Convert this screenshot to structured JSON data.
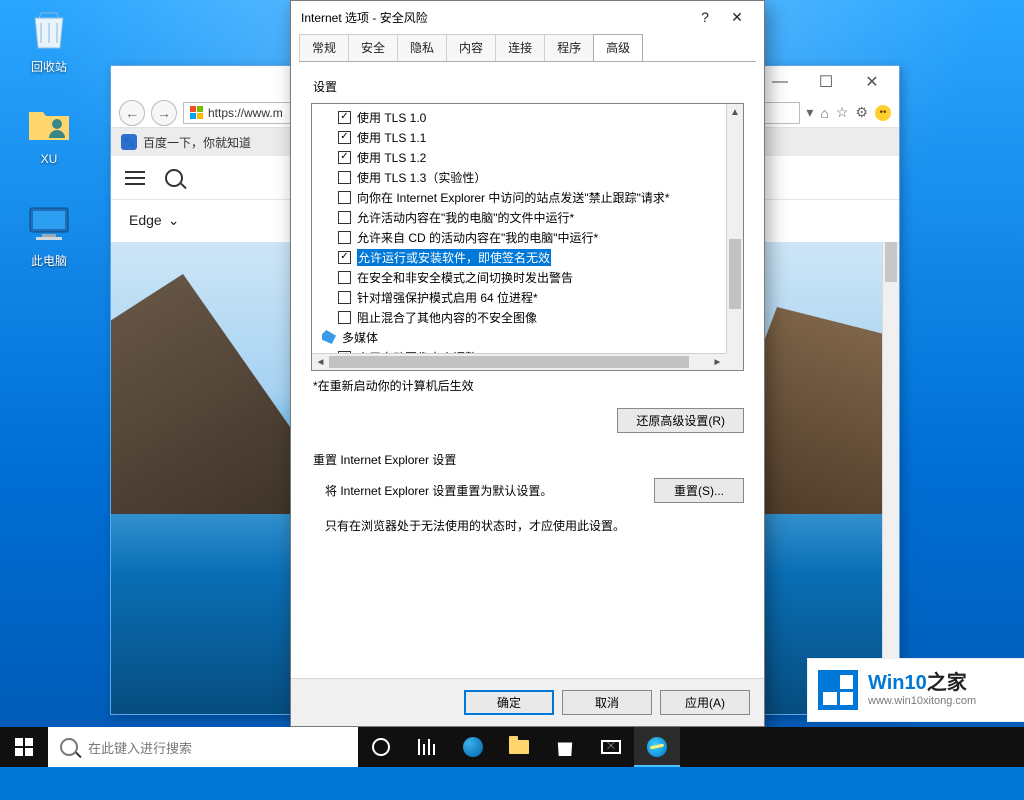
{
  "desktop": {
    "icons": {
      "recycle": "回收站",
      "xu": "XU",
      "pc": "此电脑"
    }
  },
  "ie": {
    "url_prefix": "https://www.m",
    "tab": "百度一下，你就知道",
    "edge_label": "Edge"
  },
  "dialog": {
    "title": "Internet 选项 - 安全风险",
    "tabs": [
      "常规",
      "安全",
      "隐私",
      "内容",
      "连接",
      "程序",
      "高级"
    ],
    "active_tab": 6,
    "settings_label": "设置",
    "items": [
      {
        "checked": true,
        "label": "使用 TLS 1.0"
      },
      {
        "checked": true,
        "label": "使用 TLS 1.1"
      },
      {
        "checked": true,
        "label": "使用 TLS 1.2"
      },
      {
        "checked": false,
        "label": "使用 TLS 1.3（实验性）"
      },
      {
        "checked": false,
        "label": "向你在 Internet Explorer 中访问的站点发送\"禁止跟踪\"请求*"
      },
      {
        "checked": false,
        "label": "允许活动内容在\"我的电脑\"的文件中运行*"
      },
      {
        "checked": false,
        "label": "允许来自 CD 的活动内容在\"我的电脑\"中运行*"
      },
      {
        "checked": true,
        "label": "允许运行或安装软件，即使签名无效",
        "highlight": true
      },
      {
        "checked": false,
        "label": "在安全和非安全模式之间切换时发出警告"
      },
      {
        "checked": false,
        "label": "针对增强保护模式启用 64 位进程*"
      },
      {
        "checked": false,
        "label": "阻止混合了其他内容的不安全图像"
      }
    ],
    "multimedia_label": "多媒体",
    "multimedia_items": [
      {
        "checked": true,
        "label": "启用自动图像大小调整"
      }
    ],
    "restart_note": "*在重新启动你的计算机后生效",
    "restore_btn": "还原高级设置(R)",
    "reset_section": "重置 Internet Explorer 设置",
    "reset_desc": "将 Internet Explorer 设置重置为默认设置。",
    "reset_btn": "重置(S)...",
    "reset_note": "只有在浏览器处于无法使用的状态时，才应使用此设置。",
    "ok": "确定",
    "cancel": "取消",
    "apply": "应用(A)"
  },
  "watermark": {
    "brand1": "Win10",
    "brand2": "之家",
    "url": "www.win10xitong.com"
  },
  "taskbar": {
    "search_placeholder": "在此键入进行搜索"
  }
}
